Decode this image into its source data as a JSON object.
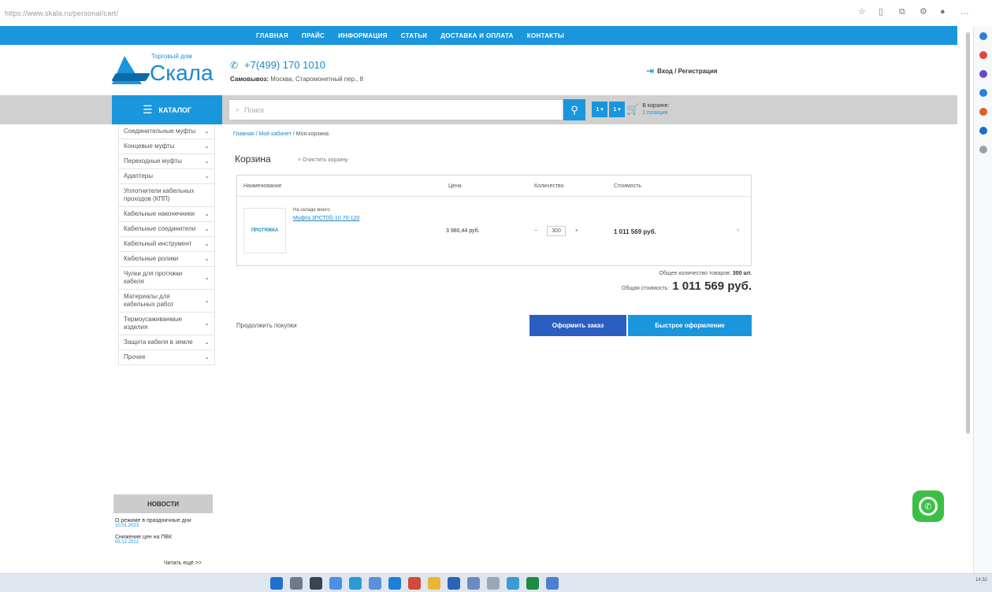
{
  "browser": {
    "url": "https://www.skala.ru/personal/cart/",
    "taskbar_clock": "14:32"
  },
  "topnav": {
    "items": [
      "ГЛАВНАЯ",
      "ПРАЙС",
      "ИНФОРМАЦИЯ",
      "СТАТЬИ",
      "ДОСТАВКА И ОПЛАТА",
      "КОНТАКТЫ"
    ]
  },
  "header": {
    "logo_small": "Торговый дом",
    "logo_big": "Скала",
    "phone": "+7(499) 170 1010",
    "address_label": "Самовывоз:",
    "address_value": "Москва, Старомонетный пер., 8",
    "login": "Вход / Регистрация"
  },
  "searchbar": {
    "catalog_label": "КАТАЛОГ",
    "search_placeholder": "Поиск",
    "mini_btn_1": "1 ▾",
    "mini_btn_2": "1 ▾",
    "cart_label": "В корзине:",
    "cart_count": "1 позиция"
  },
  "categories": [
    "Соединительные муфты",
    "Концевые муфты",
    "Переходные муфты",
    "Адаптеры",
    "Уплотнители кабельных проходов (КПП)",
    "Кабельные наконечники",
    "Кабельные соединители",
    "Кабельный инструмент",
    "Кабельные ролики",
    "Чулки для протяжки кабеля",
    "Материалы для кабельных работ",
    "Термоусаживаемые изделия",
    "Защита кабеля в земле",
    "Прочее"
  ],
  "news": {
    "title": "НОВОСТИ",
    "items": [
      {
        "text": "О режиме в праздничные дни",
        "date": "10.01.2023"
      },
      {
        "text": "Снижение цен на ПВК",
        "date": "05.12.2022"
      }
    ],
    "all_link": "Читать ещё >>"
  },
  "main": {
    "breadcrumb_home": "Главная",
    "breadcrumb_cabinet": "Мой кабинет",
    "breadcrumb_current": "Моя корзина",
    "title": "Корзина",
    "clear_cart": "× Очистить корзину",
    "columns": [
      "Наименование",
      "Цена",
      "Количество",
      "Стоимость"
    ],
    "item": {
      "image_label": "ПРОТЯЖКА",
      "note": "На складе много",
      "name": "Муфта 3ПСТ(б)-10 70-120",
      "price": "3 980,44 руб.",
      "qty": "300",
      "cost": "1 011 569 руб."
    },
    "total_qty_label": "Общее количество товаров:",
    "total_qty_value": "300 шт.",
    "total_cost_label": "Общая стоимость:",
    "total_cost_value": "1 011 569 руб.",
    "continue": "Продолжить покупки",
    "order_btn": "Оформить заказ",
    "quick_btn": "Быстрое оформление"
  },
  "colors": {
    "brand_blue": "#1a96dd",
    "order_blue": "#2c5ec2",
    "whatsapp_green": "#3bbf45"
  }
}
